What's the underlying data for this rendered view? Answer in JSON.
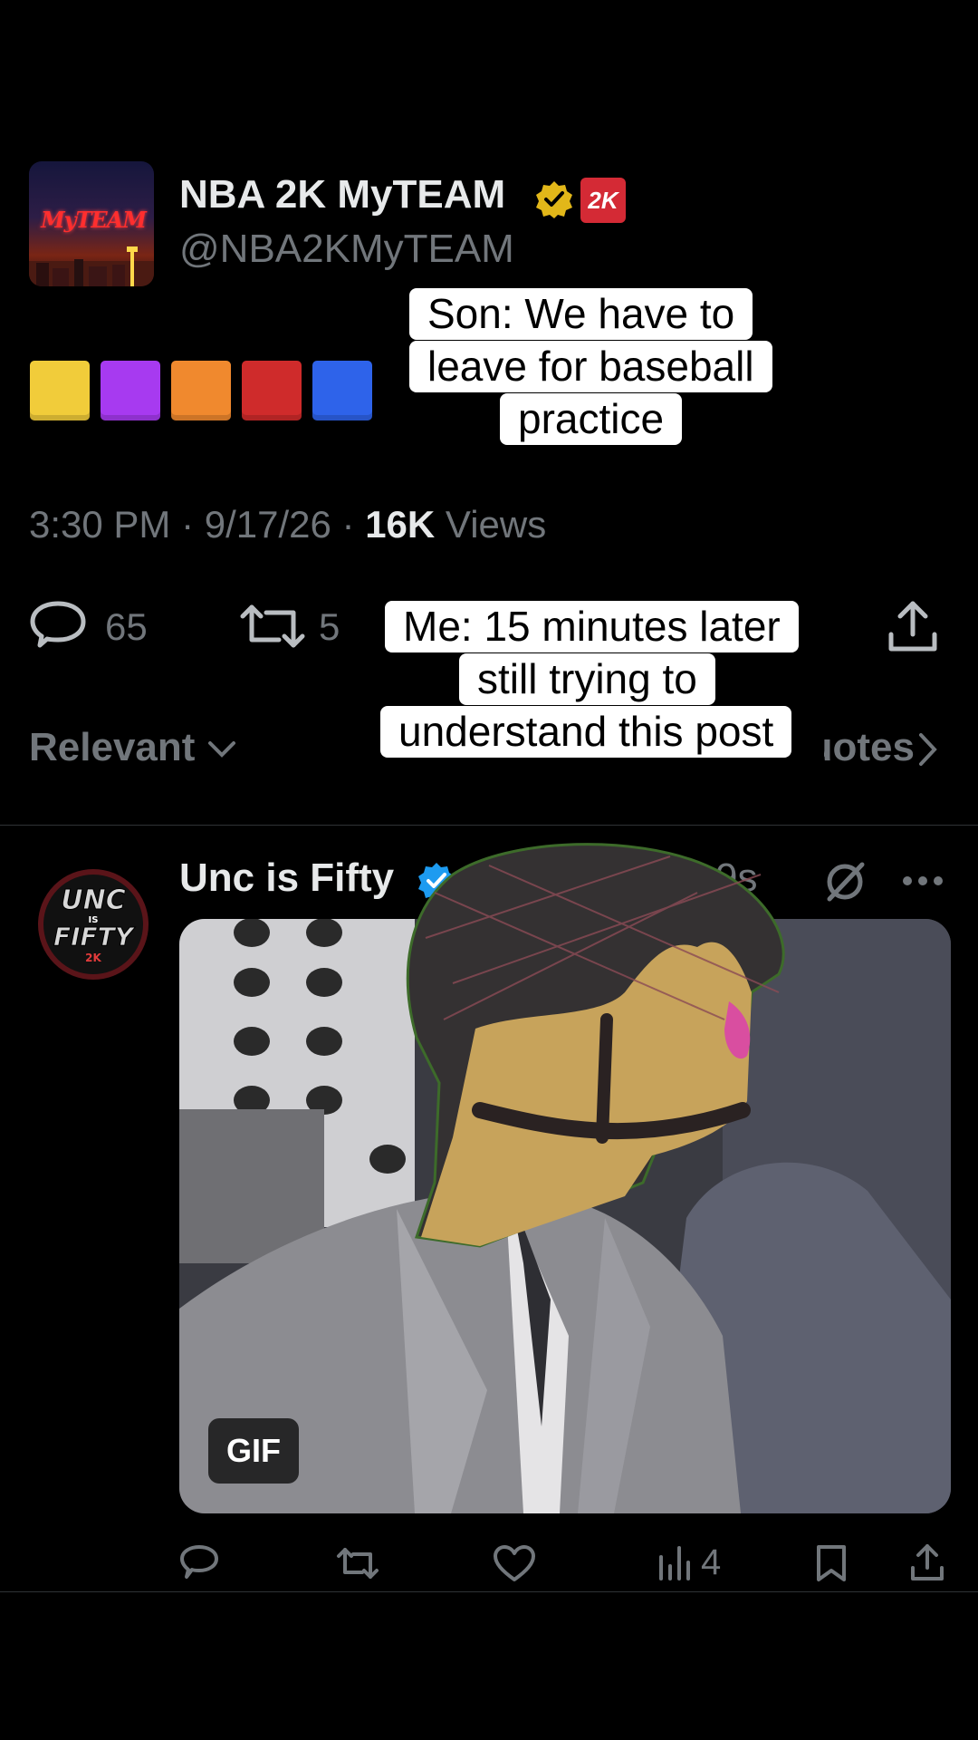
{
  "tweet": {
    "display_name": "NBA 2K MyTEAM",
    "handle": "@NBA2KMyTEAM",
    "avatar_text": "MyTEAM",
    "badge_2k": "2K",
    "square_colors": [
      "#f1cc3a",
      "#a73af0",
      "#f0892e",
      "#cf2b2b",
      "#2e63ea"
    ],
    "time": "3:30 PM · 9/17/26 · ",
    "views_count": "16K",
    "views_label": " Views",
    "replies": "65",
    "reposts": "5",
    "sort_label": "Relevant",
    "quotes_label": "Quotes"
  },
  "captions": {
    "son_line1": "Son: We have to",
    "son_line2": "leave for baseball",
    "son_line3": "practice",
    "me_line1": "Me: 15 minutes later",
    "me_line2": "still trying to",
    "me_line3": "understand this post"
  },
  "reply": {
    "display_name": "Unc is Fifty",
    "time": "9s",
    "avatar_line1": "UNC",
    "avatar_line2": "IS",
    "avatar_line3": "FIFTY",
    "avatar_line4": "2K",
    "gif_label": "GIF",
    "views": "4"
  },
  "colors": {
    "background": "#000000",
    "text_primary": "#e7e9ea",
    "text_secondary": "#71767b",
    "verified_blue": "#1d9bf0",
    "verified_gold": "#e2b719"
  }
}
